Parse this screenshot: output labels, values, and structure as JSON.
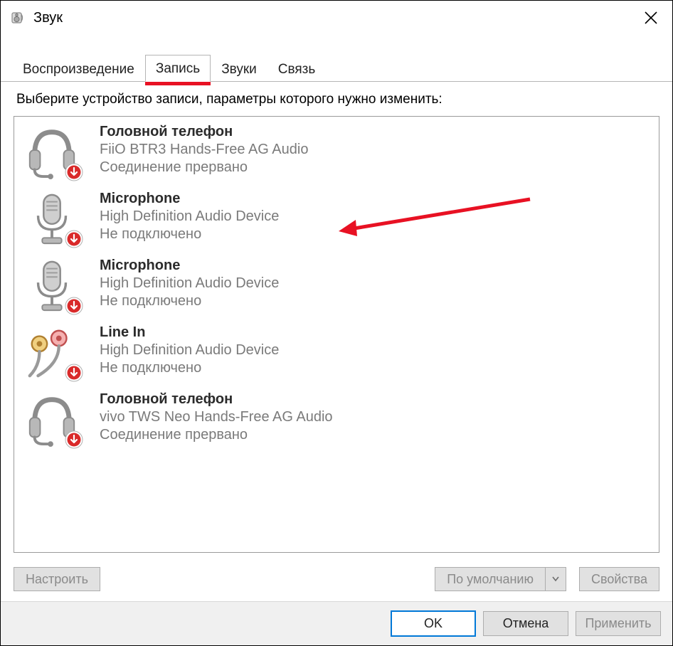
{
  "titlebar": {
    "title": "Звук"
  },
  "tabs": [
    {
      "label": "Воспроизведение"
    },
    {
      "label": "Запись"
    },
    {
      "label": "Звуки"
    },
    {
      "label": "Связь"
    }
  ],
  "active_tab_index": 1,
  "instruction": "Выберите устройство записи, параметры которого нужно изменить:",
  "devices": [
    {
      "name": "Головной телефон",
      "sub": "FiiO BTR3 Hands-Free AG Audio",
      "status": "Соединение прервано",
      "icon": "headset"
    },
    {
      "name": "Microphone",
      "sub": "High Definition Audio Device",
      "status": "Не подключено",
      "icon": "microphone"
    },
    {
      "name": "Microphone",
      "sub": "High Definition Audio Device",
      "status": "Не подключено",
      "icon": "microphone"
    },
    {
      "name": "Line In",
      "sub": "High Definition Audio Device",
      "status": "Не подключено",
      "icon": "linein"
    },
    {
      "name": "Головной телефон",
      "sub": "vivo TWS Neo Hands-Free AG Audio",
      "status": "Соединение прервано",
      "icon": "headset"
    }
  ],
  "inner_buttons": {
    "configure": "Настроить",
    "default": "По умолчанию",
    "properties": "Свойства"
  },
  "footer": {
    "ok": "OK",
    "cancel": "Отмена",
    "apply": "Применить"
  }
}
